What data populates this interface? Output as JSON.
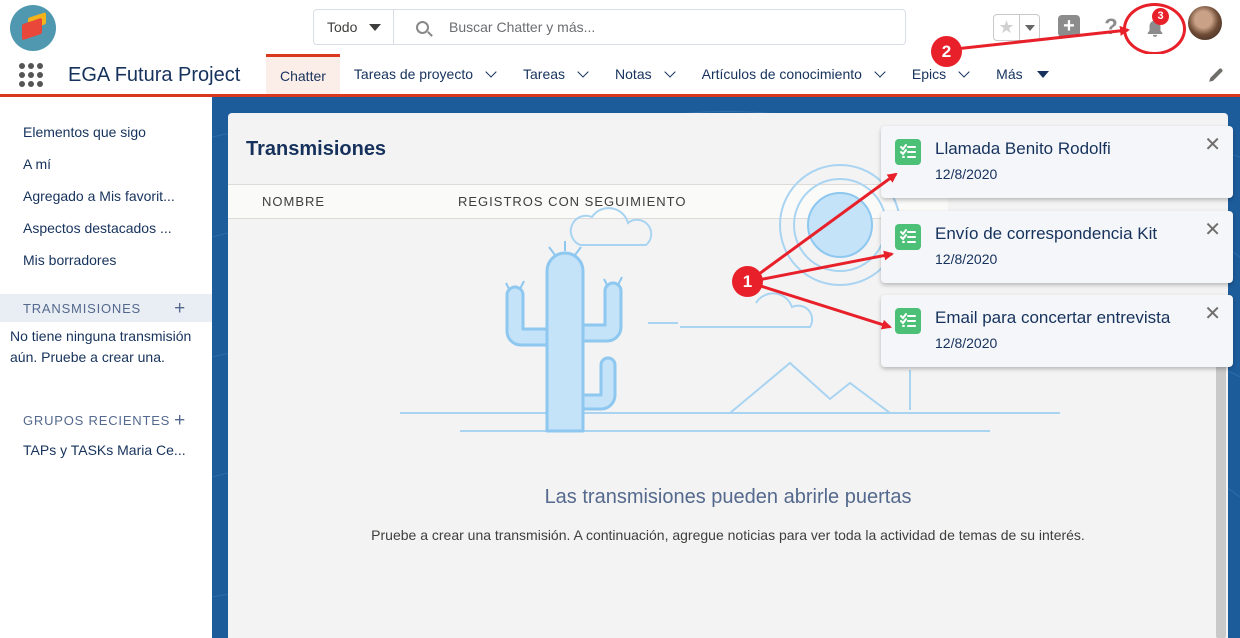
{
  "header": {
    "search_scope": "Todo",
    "search_placeholder": "Buscar Chatter y más...",
    "notification_count": "3"
  },
  "nav": {
    "app_name": "EGA Futura Project",
    "tabs": [
      {
        "label": "Chatter"
      },
      {
        "label": "Tareas de proyecto"
      },
      {
        "label": "Tareas"
      },
      {
        "label": "Notas"
      },
      {
        "label": "Artículos de conocimiento"
      },
      {
        "label": "Epics"
      },
      {
        "label": "Más"
      }
    ]
  },
  "sidebar": {
    "items": [
      {
        "label": "Elementos que sigo"
      },
      {
        "label": "A mí"
      },
      {
        "label": "Agregado a Mis favorit..."
      },
      {
        "label": "Aspectos destacados ..."
      },
      {
        "label": "Mis borradores"
      }
    ],
    "streams_heading": "TRANSMISIONES",
    "streams_empty": "No tiene ninguna transmisión aún. Pruebe a crear una.",
    "groups_heading": "GRUPOS RECIENTES",
    "groups": [
      {
        "label": "TAPs y TASKs Maria Ce..."
      }
    ]
  },
  "main": {
    "title": "Transmisiones",
    "columns": [
      "NOMBRE",
      "REGISTROS CON SEGUIMIENTO"
    ],
    "empty_title": "Las transmisiones pueden abrirle puertas",
    "empty_subtitle": "Pruebe a crear una transmisión. A continuación, agregue noticias para ver toda la actividad de temas de su interés."
  },
  "notifications": [
    {
      "title": "Llamada Benito Rodolfi",
      "date": "12/8/2020"
    },
    {
      "title": "Envío de correspondencia Kit",
      "date": "12/8/2020"
    },
    {
      "title": "Email para concertar entrevista",
      "date": "12/8/2020"
    }
  ],
  "annotations": {
    "marker_1": "1",
    "marker_2": "2",
    "color": "#e8202a"
  },
  "colors": {
    "brand_red": "#d9381e",
    "task_green": "#4bc076",
    "background_blue": "#1d5c9b",
    "text_navy": "#16325c"
  }
}
